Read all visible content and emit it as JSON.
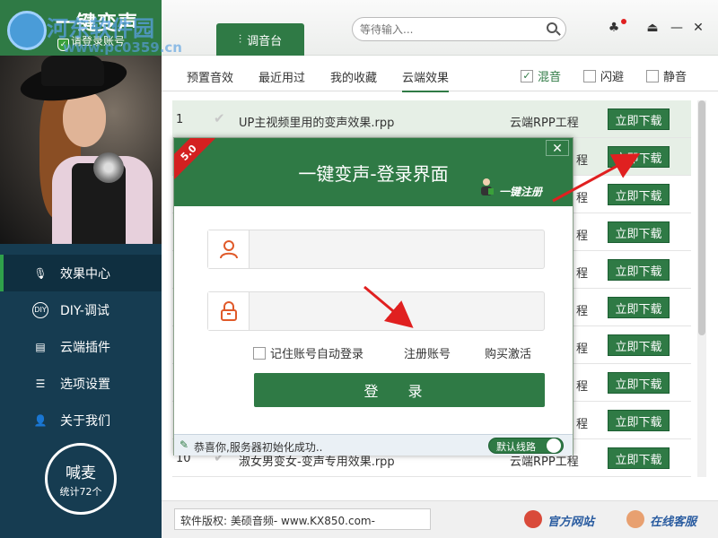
{
  "app": {
    "title": "一键变声",
    "login_hint": "请登录账号"
  },
  "watermark": {
    "line1": "河东软件园",
    "line2": "www.pc0359.cn"
  },
  "header": {
    "main_tab": "调音台",
    "search_placeholder": "等待输入...",
    "icons": [
      "skin-icon",
      "collapse-icon",
      "minimize-icon",
      "close-icon"
    ]
  },
  "sidebar": {
    "items": [
      {
        "label": "效果中心",
        "icon": "microphone-icon"
      },
      {
        "label": "DIY-调试",
        "icon": "diy-icon"
      },
      {
        "label": "云端插件",
        "icon": "plugin-icon"
      },
      {
        "label": "选项设置",
        "icon": "settings-icon"
      },
      {
        "label": "关于我们",
        "icon": "user-icon"
      }
    ],
    "shout": {
      "label": "喊麦",
      "stats": "统计72个"
    }
  },
  "subtabs": [
    "预置音效",
    "最近用过",
    "我的收藏",
    "云端效果"
  ],
  "checkboxes": [
    {
      "label": "混音",
      "checked": true
    },
    {
      "label": "闪避",
      "checked": false
    },
    {
      "label": "静音",
      "checked": false
    }
  ],
  "list": {
    "download_label": "立即下载",
    "rows": [
      {
        "idx": "1",
        "name": "UP主视频里用的变声效果.rpp",
        "type": "云端RPP工程"
      },
      {
        "idx": "",
        "name": "",
        "type": "程"
      },
      {
        "idx": "",
        "name": "",
        "type": "程"
      },
      {
        "idx": "",
        "name": "",
        "type": "程"
      },
      {
        "idx": "",
        "name": "",
        "type": "程"
      },
      {
        "idx": "",
        "name": "",
        "type": "程"
      },
      {
        "idx": "",
        "name": "",
        "type": "程"
      },
      {
        "idx": "",
        "name": "",
        "type": "程"
      },
      {
        "idx": "",
        "name": "",
        "type": "程"
      },
      {
        "idx": "10",
        "name": "淑女男变女-变声专用效果.rpp",
        "type": "云端RPP工程"
      }
    ]
  },
  "footer": {
    "copyright": "软件版权:  美硕音频- www.KX850.com-",
    "official_site": "官方网站",
    "online_service": "在线客服"
  },
  "dialog": {
    "version": "5.0",
    "title": "一键变声-登录界面",
    "register_quick": "一键注册",
    "close": "✕",
    "remember": "记住账号自动登录",
    "register": "注册账号",
    "buy": "购买激活",
    "login_button": "登 录",
    "status": "恭喜你,服务器初始化成功..",
    "line_toggle": "默认线路"
  },
  "colors": {
    "accent": "#2f7a45",
    "sidebar": "#163c51",
    "arrow": "#e02020"
  }
}
